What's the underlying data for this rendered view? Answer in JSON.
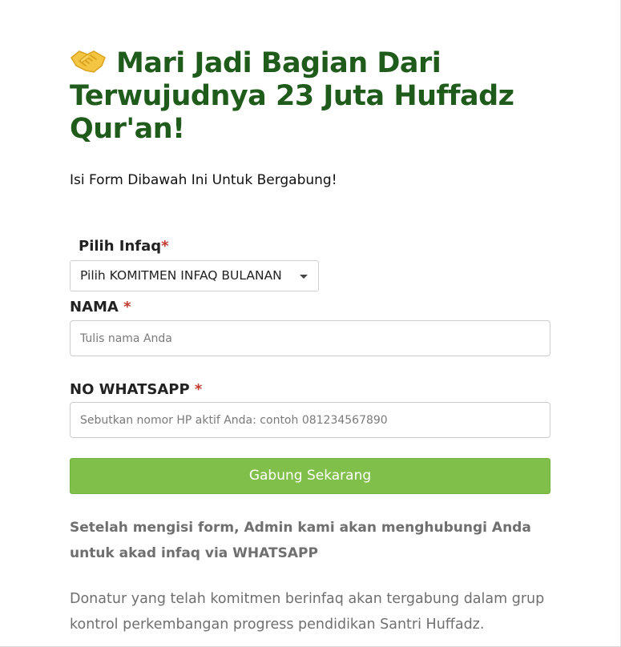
{
  "header": {
    "icon": "handshake-icon",
    "title": "Mari Jadi Bagian Dari Terwujudnya 23 Juta Huffadz Qur'an!",
    "subtitle": "Isi Form Dibawah Ini Untuk Bergabung!"
  },
  "form": {
    "infaq": {
      "label": "Pilih Infaq",
      "required_mark": "*",
      "selected": "Pilih KOMITMEN INFAQ BULANAN"
    },
    "nama": {
      "label": "NAMA ",
      "required_mark": "*",
      "value": "",
      "placeholder": "Tulis nama Anda"
    },
    "whatsapp": {
      "label": "NO WHATSAPP ",
      "required_mark": "*",
      "value": "",
      "placeholder": "Sebutkan nomor HP aktif Anda: contoh 081234567890"
    },
    "submit_label": "Gabung Sekarang"
  },
  "footer": {
    "note": "Setelah mengisi form, Admin kami akan menghubungi Anda untuk akad infaq via WHATSAPP",
    "info": "Donatur yang telah komitmen berinfaq akan tergabung dalam grup kontrol perkembangan progress pendidikan Santri Huffadz."
  },
  "colors": {
    "title": "#1f5b1b",
    "button": "#80bf4a",
    "required": "#c0392b",
    "muted_text": "#6f6f6f"
  }
}
